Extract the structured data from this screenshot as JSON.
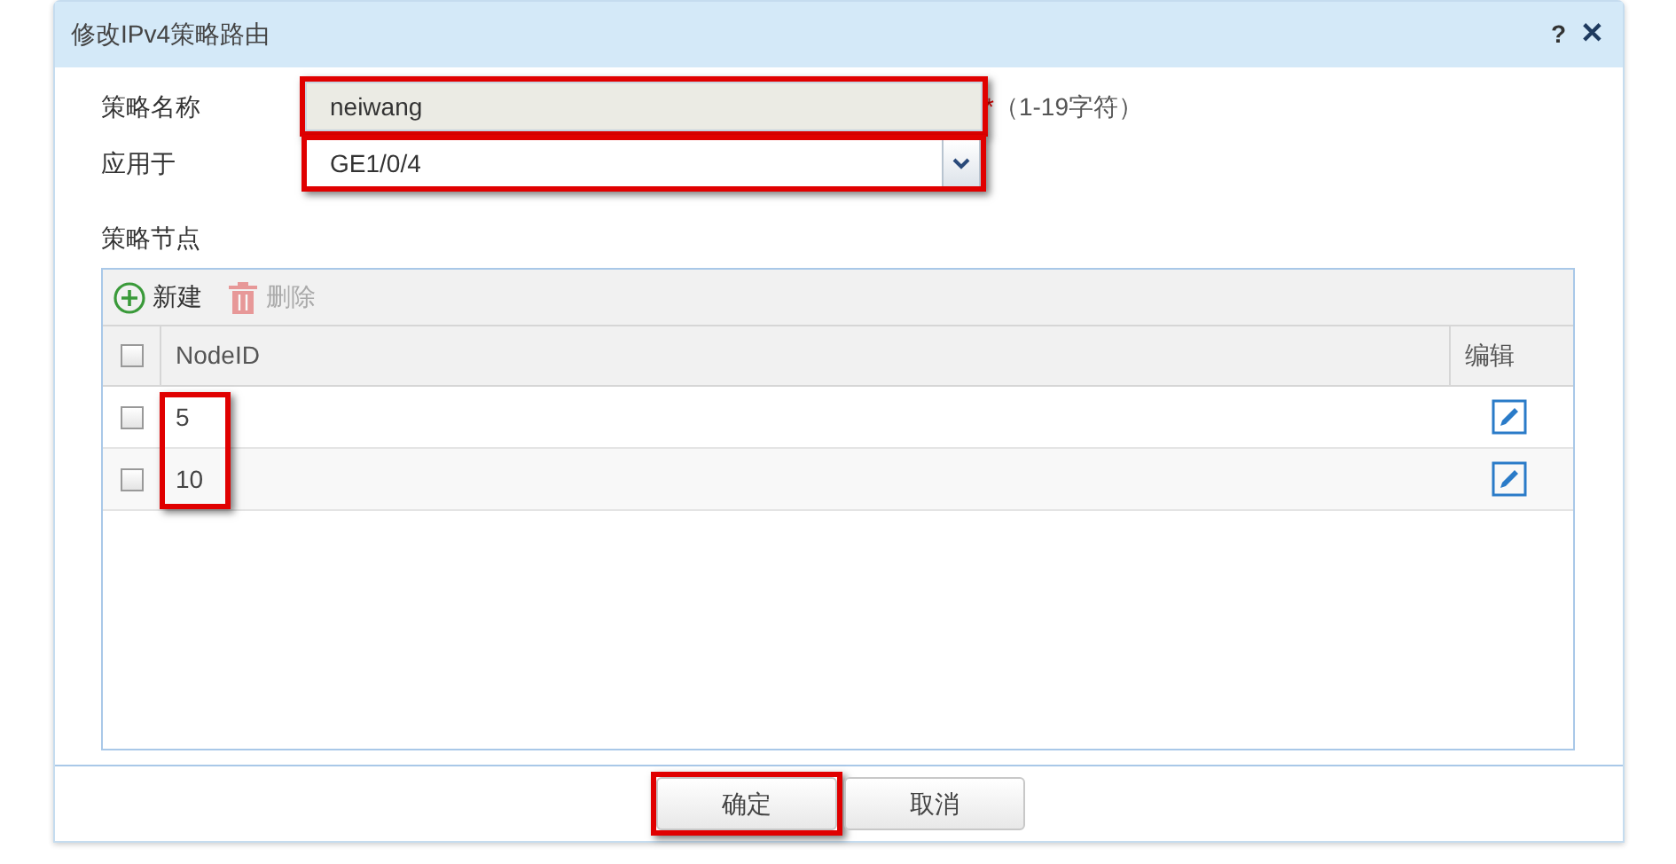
{
  "window": {
    "title": "修改IPv4策略路由",
    "help": "?",
    "close": "✕"
  },
  "form": {
    "name": {
      "label": "策略名称",
      "value": "neiwang",
      "disabled": true,
      "highlighted": true,
      "required_mark": "*",
      "hint": "（1-19字符）"
    },
    "apply_to": {
      "label": "应用于",
      "value": "GE1/0/4",
      "highlighted": true
    }
  },
  "nodes": {
    "title": "策略节点",
    "toolbar": [
      {
        "kind": "add",
        "label": "新建",
        "disabled": false
      },
      {
        "kind": "delete",
        "label": "删除",
        "disabled": true
      }
    ],
    "columns": [
      "NodeID",
      "编辑"
    ],
    "ids_highlighted": true,
    "all_checked": false,
    "rows": [
      {
        "id": "5",
        "checked": false
      },
      {
        "id": "10",
        "checked": false
      }
    ]
  },
  "buttons": [
    {
      "label": "确定",
      "highlighted": true
    },
    {
      "label": "取消",
      "highlighted": false
    }
  ]
}
